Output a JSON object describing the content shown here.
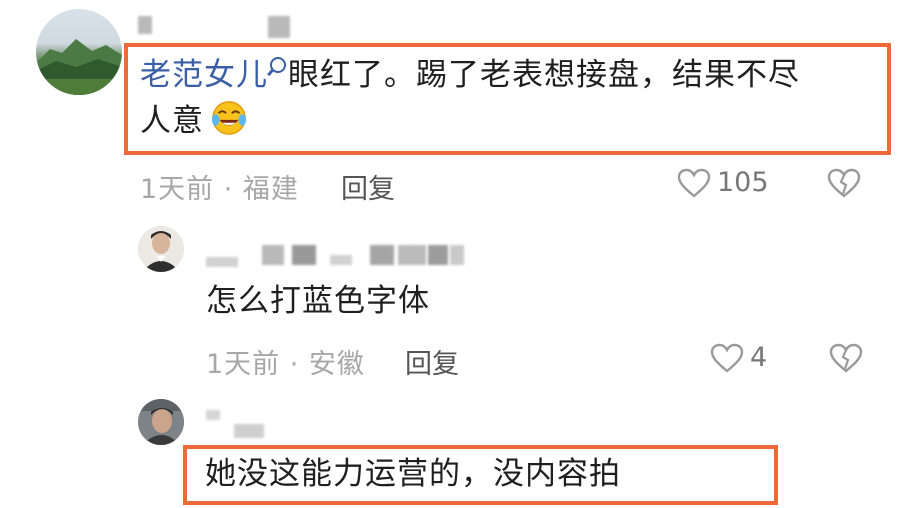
{
  "comments": [
    {
      "username": "老范女儿",
      "text": "眼红了。踢了老表想接盘，结果不尽",
      "text_line2": "人意",
      "emoji": "laughing-tears-emoji",
      "time": "1天前",
      "location": "福建",
      "meta": "1天前 · 福建",
      "reply_label": "回复",
      "likes": "105"
    },
    {
      "text": "怎么打蓝色字体",
      "meta": "1天前 · 安徽",
      "reply_label": "回复",
      "likes": "4"
    },
    {
      "text": "她没这能力运营的，没内容拍"
    }
  ],
  "colors": {
    "highlight": "#ee6a39",
    "link": "#3a5fa6",
    "meta": "#a7a7a7"
  },
  "icons": [
    "heart-outline-icon",
    "broken-heart-icon",
    "search-icon"
  ]
}
